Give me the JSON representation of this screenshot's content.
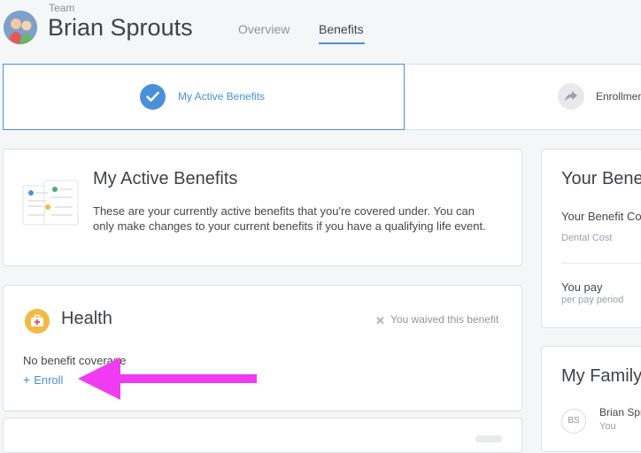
{
  "header": {
    "team_label": "Team",
    "person_name": "Brian Sprouts",
    "tabs": [
      {
        "label": "Overview",
        "active": false
      },
      {
        "label": "Benefits",
        "active": true
      }
    ]
  },
  "steps": {
    "active_label": "My Active Benefits",
    "next_label": "Enrollment"
  },
  "intro": {
    "title": "My Active Benefits",
    "description": "These are your currently active benefits that you're covered under. You can only make changes to your current benefits if you have a qualifying life event."
  },
  "health": {
    "title": "Health",
    "waived_text": "You waived this benefit",
    "no_coverage": "No benefit coverage",
    "enroll_label": "Enroll"
  },
  "cost_panel": {
    "title": "Your Benefits",
    "benefit_cost_label": "Your Benefit Cost",
    "dental_cost_label": "Dental Cost",
    "you_pay_label": "You pay",
    "per_period_label": "per pay period"
  },
  "family": {
    "title": "My Family",
    "member_initials": "BS",
    "member_name": "Brian Sprouts",
    "member_role": "You"
  },
  "colors": {
    "accent": "#4a90d9",
    "annotation_arrow": "#f03cf0",
    "health_icon": "#f3b942"
  }
}
